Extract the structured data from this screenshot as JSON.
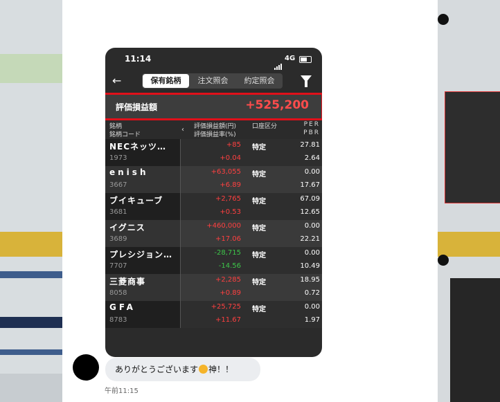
{
  "status": {
    "time": "11:14",
    "network": "4G"
  },
  "nav": {
    "tabs": [
      {
        "label": "保有銘柄"
      },
      {
        "label": "注文照会"
      },
      {
        "label": "約定照会"
      }
    ]
  },
  "summary": {
    "label": "評価損益額",
    "value": "+525,200"
  },
  "headers": {
    "col1a": "銘柄",
    "col1b": "銘柄コード",
    "col2a": "評価損益額(円)",
    "col2b": "評価損益率(%)",
    "col3a": "口座区分",
    "col4a": "PER",
    "col4b": "PBR"
  },
  "rows": [
    {
      "name": "NECネッツ…",
      "code": "1973",
      "amount": "+85",
      "rate": "+0.04",
      "account": "特定",
      "per": "27.81",
      "pbr": "2.64"
    },
    {
      "name": "enish",
      "code": "3667",
      "amount": "+63,055",
      "rate": "+6.89",
      "account": "特定",
      "per": "0.00",
      "pbr": "17.67"
    },
    {
      "name": "ブイキューブ",
      "code": "3681",
      "amount": "+2,765",
      "rate": "+0.53",
      "account": "特定",
      "per": "67.09",
      "pbr": "12.65"
    },
    {
      "name": "イグニス",
      "code": "3689",
      "amount": "+460,000",
      "rate": "+17.06",
      "account": "特定",
      "per": "0.00",
      "pbr": "22.21"
    },
    {
      "name": "プレシジョン…",
      "code": "7707",
      "amount": "-28,715",
      "rate": "-14.56",
      "account": "特定",
      "per": "0.00",
      "pbr": "10.49"
    },
    {
      "name": "三菱商事",
      "code": "8058",
      "amount": "+2,285",
      "rate": "+0.89",
      "account": "特定",
      "per": "18.95",
      "pbr": "0.72"
    },
    {
      "name": "GFA",
      "code": "8783",
      "amount": "+25,725",
      "rate": "+11.67",
      "account": "特定",
      "per": "0.00",
      "pbr": "1.97"
    }
  ],
  "chat": {
    "message_before": "ありがとうございます",
    "message_after": "神！！",
    "time": "午前11:15"
  },
  "colors": {
    "positive": "#ff4040",
    "negative": "#3ec74a",
    "highlight_border": "#e0101a"
  }
}
